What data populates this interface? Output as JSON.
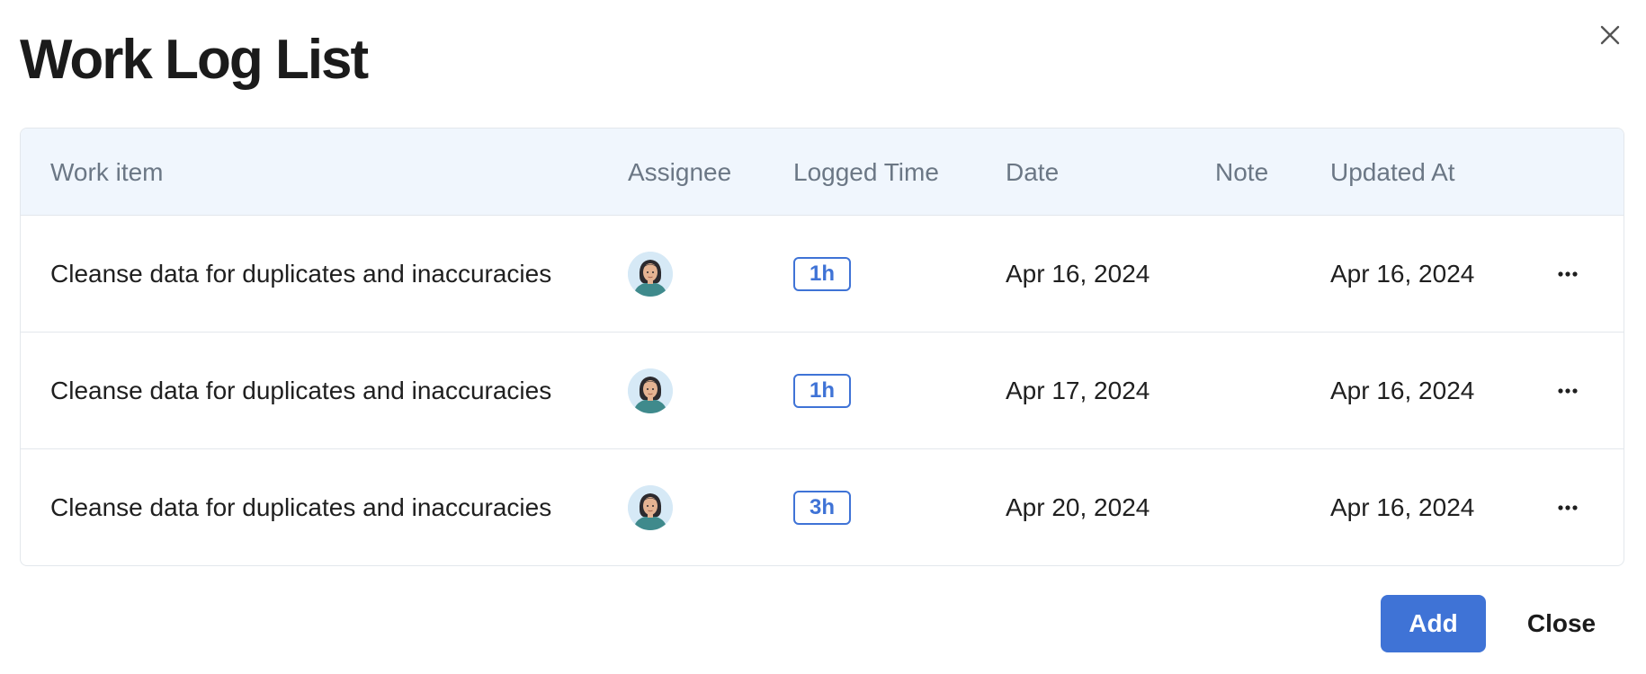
{
  "dialog": {
    "title": "Work Log List"
  },
  "table": {
    "headers": {
      "work_item": "Work item",
      "assignee": "Assignee",
      "logged_time": "Logged Time",
      "date": "Date",
      "note": "Note",
      "updated_at": "Updated At"
    },
    "rows": [
      {
        "work_item": "Cleanse data for duplicates and inaccuracies",
        "logged_time": "1h",
        "date": "Apr 16, 2024",
        "note": "",
        "updated_at": "Apr 16, 2024"
      },
      {
        "work_item": "Cleanse data for duplicates and inaccuracies",
        "logged_time": "1h",
        "date": "Apr 17, 2024",
        "note": "",
        "updated_at": "Apr 16, 2024"
      },
      {
        "work_item": "Cleanse data for duplicates and inaccuracies",
        "logged_time": "3h",
        "date": "Apr 20, 2024",
        "note": "",
        "updated_at": "Apr 16, 2024"
      }
    ]
  },
  "footer": {
    "add_label": "Add",
    "close_label": "Close"
  },
  "icons": {
    "close": "close-icon",
    "more": "more-horizontal-icon",
    "avatar": "user-avatar"
  },
  "colors": {
    "accent": "#3f73d6",
    "header_bg": "#f0f6fd",
    "header_text": "#6b7785",
    "border": "#e3e7ec"
  }
}
